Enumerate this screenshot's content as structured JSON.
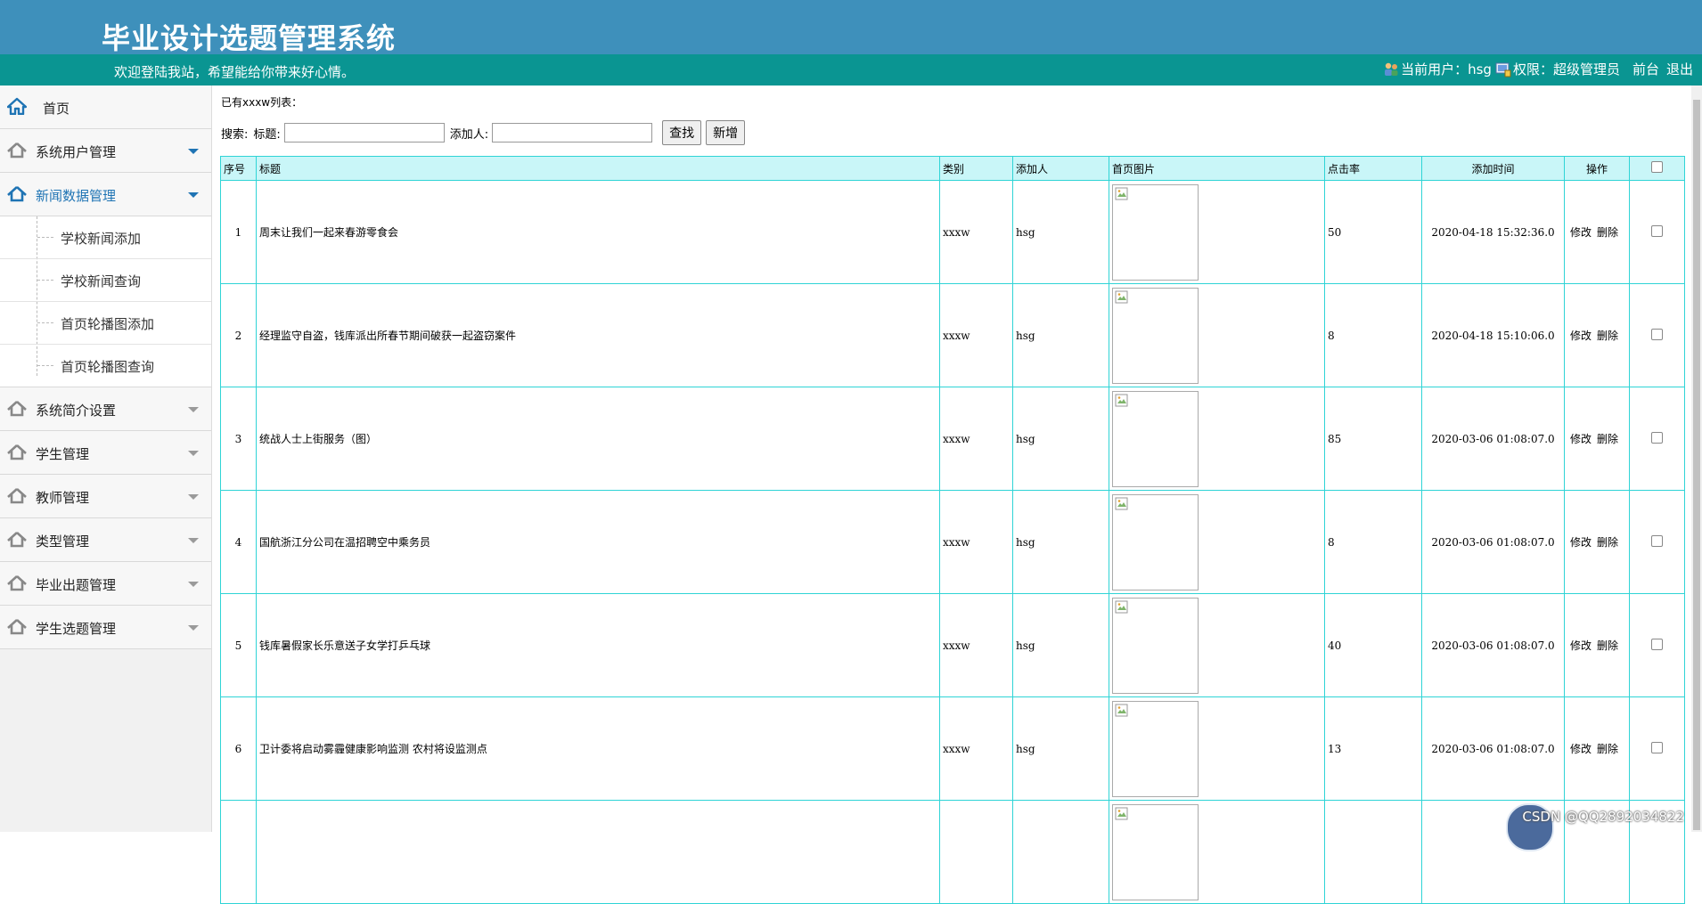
{
  "header": {
    "title": "毕业设计选题管理系统",
    "welcome": "欢迎登陆我站，希望能给你带来好心情。",
    "current_user_label": "当前用户：hsg",
    "permission_label": "权限：超级管理员",
    "front_link": "前台",
    "logout_link": "退出"
  },
  "sidebar": {
    "home": "首页",
    "items": [
      {
        "label": "系统用户管理"
      },
      {
        "label": "新闻数据管理",
        "sub": [
          "学校新闻添加",
          "学校新闻查询",
          "首页轮播图添加",
          "首页轮播图查询"
        ]
      },
      {
        "label": "系统简介设置"
      },
      {
        "label": "学生管理"
      },
      {
        "label": "教师管理"
      },
      {
        "label": "类型管理"
      },
      {
        "label": "毕业出题管理"
      },
      {
        "label": "学生选题管理"
      }
    ]
  },
  "main": {
    "list_title": "已有xxxw列表：",
    "search": {
      "label": "搜索:",
      "title_label": "标题:",
      "adder_label": "添加人:",
      "find_button": "查找",
      "add_button": "新增"
    },
    "columns": [
      "序号",
      "标题",
      "类别",
      "添加人",
      "首页图片",
      "点击率",
      "添加时间",
      "操作"
    ],
    "edit_label": "修改",
    "delete_label": "删除",
    "rows": [
      {
        "no": "1",
        "title": "周末让我们一起来春游零食会",
        "category": "xxxw",
        "adder": "hsg",
        "clicks": "50",
        "time": "2020-04-18 15:32:36.0"
      },
      {
        "no": "2",
        "title": "经理监守自盗，钱库派出所春节期间破获一起盗窃案件",
        "category": "xxxw",
        "adder": "hsg",
        "clicks": "8",
        "time": "2020-04-18 15:10:06.0"
      },
      {
        "no": "3",
        "title": "统战人士上街服务（图）",
        "category": "xxxw",
        "adder": "hsg",
        "clicks": "85",
        "time": "2020-03-06 01:08:07.0"
      },
      {
        "no": "4",
        "title": "国航浙江分公司在温招聘空中乘务员",
        "category": "xxxw",
        "adder": "hsg",
        "clicks": "8",
        "time": "2020-03-06 01:08:07.0"
      },
      {
        "no": "5",
        "title": "钱库暑假家长乐意送子女学打乒乓球",
        "category": "xxxw",
        "adder": "hsg",
        "clicks": "40",
        "time": "2020-03-06 01:08:07.0"
      },
      {
        "no": "6",
        "title": "卫计委将启动雾霾健康影响监测 农村将设监测点",
        "category": "xxxw",
        "adder": "hsg",
        "clicks": "13",
        "time": "2020-03-06 01:08:07.0"
      },
      {
        "no": "",
        "title": "",
        "category": "",
        "adder": "",
        "clicks": "",
        "time": ""
      }
    ]
  },
  "watermark": "CSDN @QQ2892034822",
  "colors": {
    "header": "#3e90bb",
    "welcome_bar": "#0a9592",
    "table_border": "#2fd4d6",
    "table_header_bg": "#c9f6f8",
    "active_nav": "#1f74b4"
  }
}
